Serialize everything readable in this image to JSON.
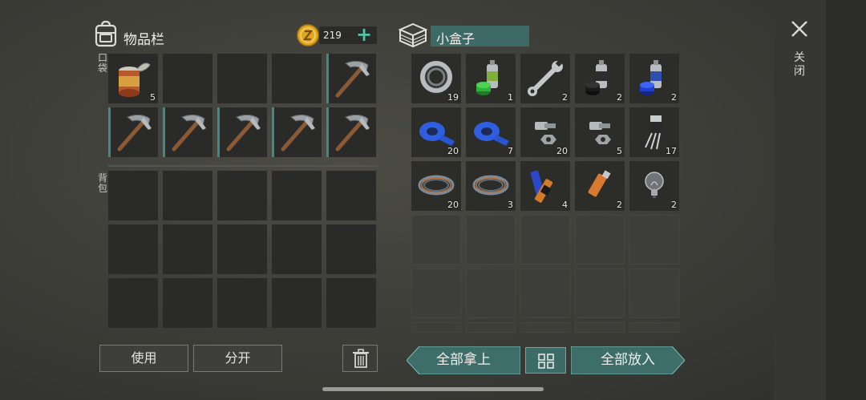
{
  "inventory": {
    "title": "物品栏",
    "coins": "219",
    "pocket_label": "口袋",
    "backpack_label": "背包"
  },
  "pocket_slots": [
    {
      "item": "tin-can",
      "qty": "5",
      "marked": false
    },
    {
      "item": "",
      "qty": "",
      "marked": false
    },
    {
      "item": "",
      "qty": "",
      "marked": false
    },
    {
      "item": "",
      "qty": "",
      "marked": false
    },
    {
      "item": "pickaxe",
      "qty": "",
      "marked": true
    },
    {
      "item": "pickaxe",
      "qty": "",
      "marked": true
    },
    {
      "item": "pickaxe",
      "qty": "",
      "marked": true
    },
    {
      "item": "pickaxe",
      "qty": "",
      "marked": true
    },
    {
      "item": "pickaxe",
      "qty": "",
      "marked": true
    },
    {
      "item": "pickaxe",
      "qty": "",
      "marked": true
    }
  ],
  "container": {
    "title": "小盒子",
    "slots": [
      {
        "item": "bearing",
        "qty": "19"
      },
      {
        "item": "spray-can-green",
        "qty": "1"
      },
      {
        "item": "wrench",
        "qty": "2"
      },
      {
        "item": "spray-can-black",
        "qty": "2"
      },
      {
        "item": "spray-can-blue",
        "qty": "2"
      },
      {
        "item": "duct-tape",
        "qty": "20"
      },
      {
        "item": "duct-tape",
        "qty": "7"
      },
      {
        "item": "nut-bolt",
        "qty": "20"
      },
      {
        "item": "nut-bolt",
        "qty": "5"
      },
      {
        "item": "transistor",
        "qty": "17"
      },
      {
        "item": "wire-coil",
        "qty": "20"
      },
      {
        "item": "wire-coil",
        "qty": "3"
      },
      {
        "item": "batteries",
        "qty": "4"
      },
      {
        "item": "usb-drive",
        "qty": "2"
      },
      {
        "item": "light-bulb",
        "qty": "2"
      }
    ]
  },
  "buttons": {
    "use": "使用",
    "split": "分开",
    "take_all": "全部拿上",
    "put_all": "全部放入"
  },
  "close": {
    "label": "关闭"
  },
  "colors": {
    "accent": "#3d6b67",
    "accent_arrow": "#3d6e6a",
    "plus": "#4fc3a8",
    "slot": "#2c2c29",
    "coin": "#e0a822"
  }
}
